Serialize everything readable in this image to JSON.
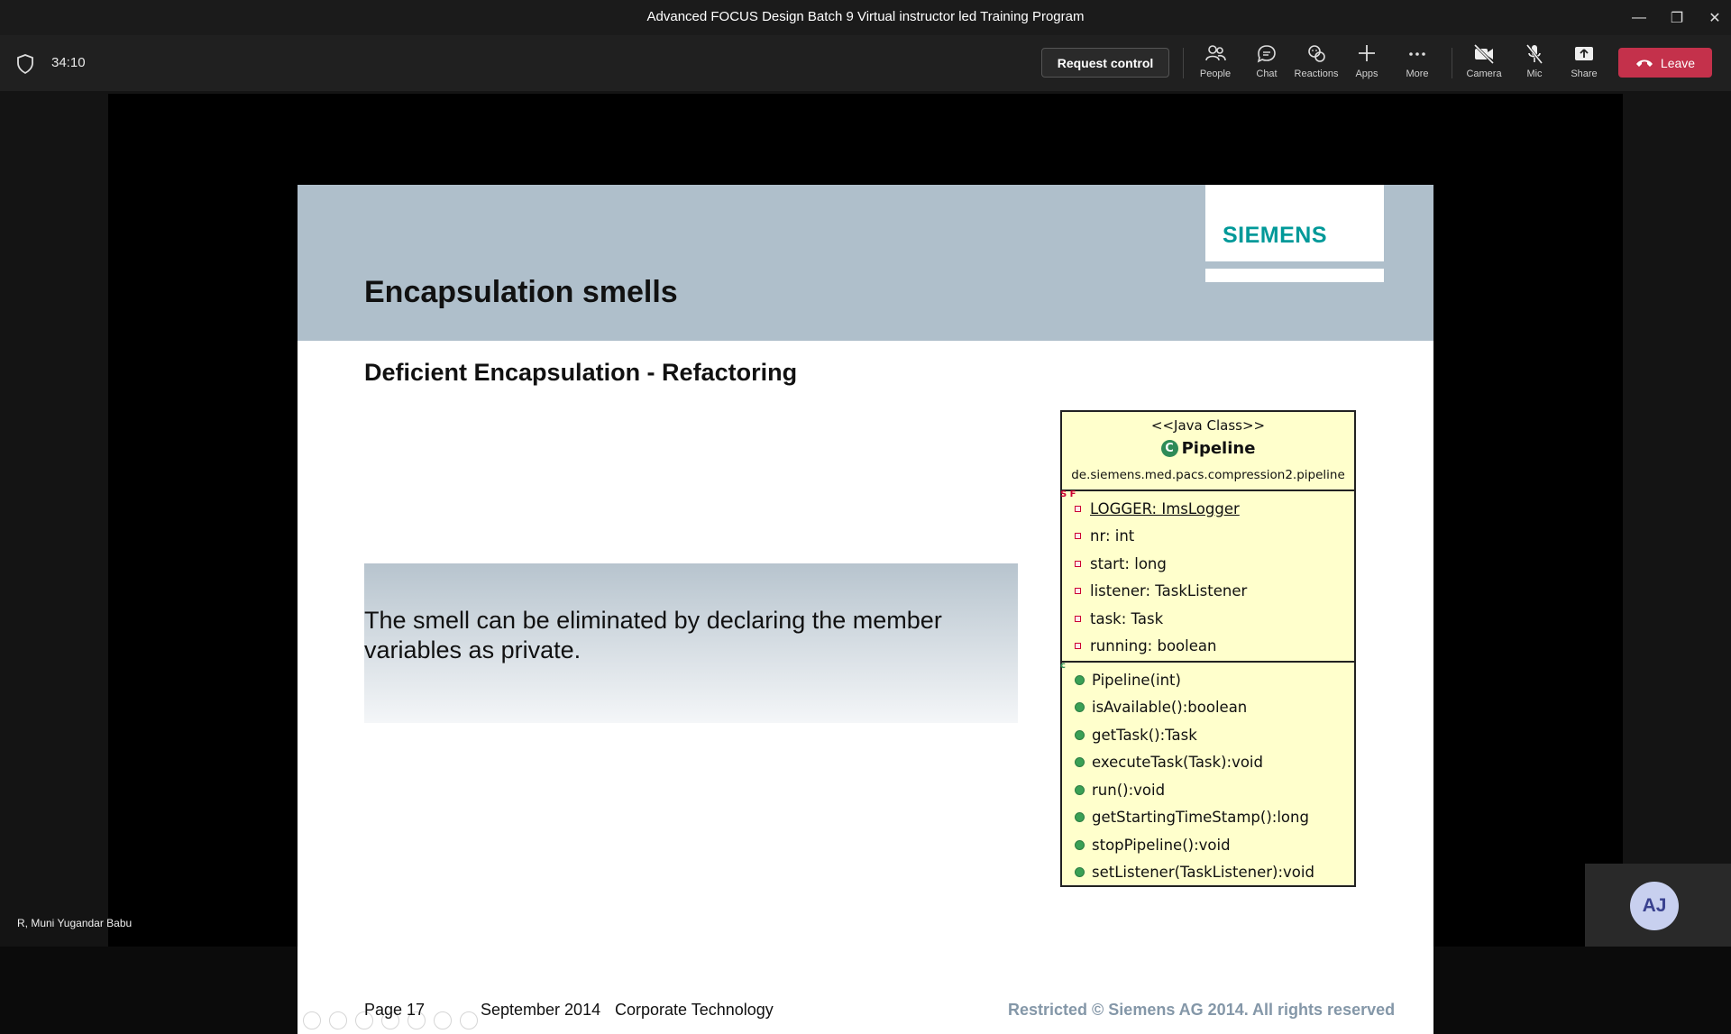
{
  "window": {
    "title": "Advanced FOCUS Design Batch 9 Virtual instructor led Training Program",
    "controls": {
      "minimize": "—",
      "restore": "❐",
      "close": "✕"
    }
  },
  "toolbar": {
    "timer": "34:10",
    "request_control": "Request control",
    "people": "People",
    "chat": "Chat",
    "reactions": "Reactions",
    "apps": "Apps",
    "more": "More",
    "camera": "Camera",
    "mic": "Mic",
    "share": "Share",
    "leave": "Leave",
    "leave_color": "#c4314b"
  },
  "slide": {
    "title": "Encapsulation smells",
    "logo": "SIEMENS",
    "logo_color": "#009999",
    "subtitle": "Deficient Encapsulation - Refactoring",
    "callout": "The smell can be eliminated by declaring the member variables as private.",
    "uml": {
      "stereotype": "<<Java Class>>",
      "class_name": "Pipeline",
      "class_icon": "C",
      "package": "de.siemens.med.pacs.compression2.pipeline",
      "static_marker": "S F",
      "fields": [
        "LOGGER: ImsLogger",
        "nr: int",
        "start: long",
        "listener: TaskListener",
        "task: Task",
        "running: boolean"
      ],
      "constructor_marker": "c",
      "methods": [
        "Pipeline(int)",
        "isAvailable():boolean",
        "getTask():Task",
        "executeTask(Task):void",
        "run():void",
        "getStartingTimeStamp():long",
        "stopPipeline():void",
        "setListener(TaskListener):void"
      ]
    },
    "footer": {
      "page": "Page 17",
      "date": "September 2014",
      "dept": "Corporate Technology",
      "rights": "Restricted © Siemens AG 2014. All rights reserved"
    }
  },
  "participants": {
    "presenter_name": "R, Muni Yugandar Babu",
    "self_initials": "AJ"
  }
}
